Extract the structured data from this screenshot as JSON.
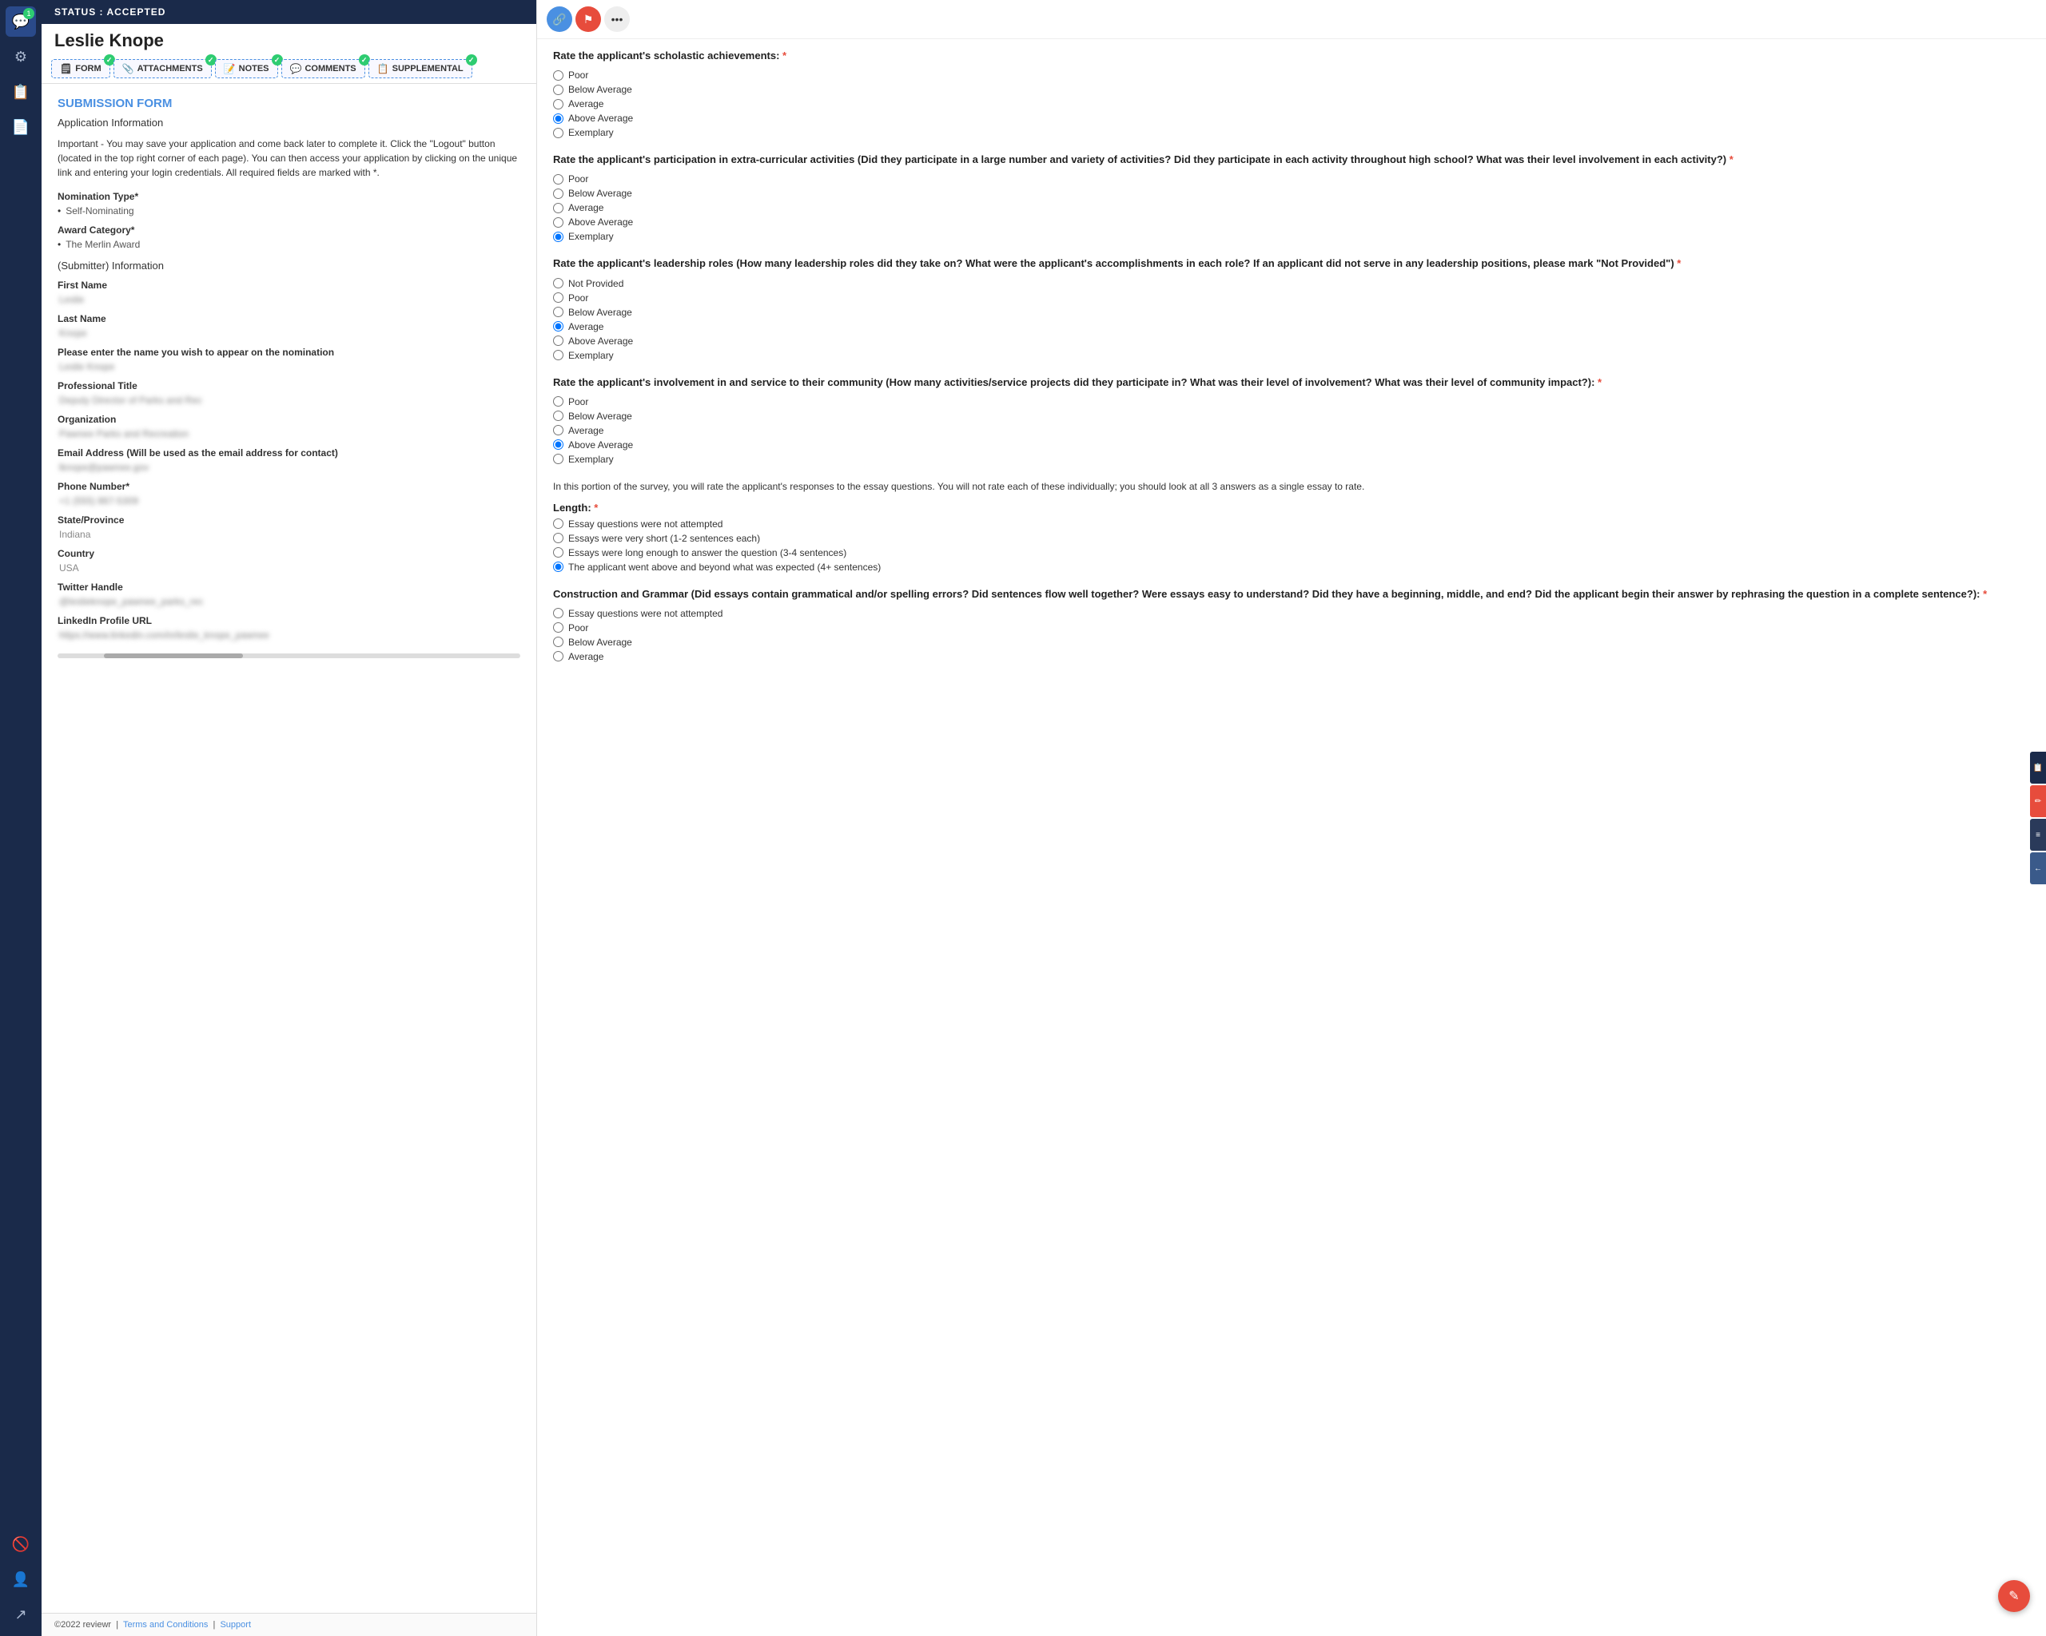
{
  "sidebar": {
    "icons": [
      {
        "name": "chat-icon",
        "symbol": "💬",
        "active": true,
        "badge": "1"
      },
      {
        "name": "settings-icon",
        "symbol": "⚙",
        "active": false
      },
      {
        "name": "clipboard-icon",
        "symbol": "📋",
        "active": false
      },
      {
        "name": "document-icon",
        "symbol": "📄",
        "active": false
      }
    ],
    "bottom_icons": [
      {
        "name": "block-icon",
        "symbol": "🚫"
      },
      {
        "name": "user-icon",
        "symbol": "👤"
      },
      {
        "name": "export-icon",
        "symbol": "↗"
      }
    ]
  },
  "status_bar": {
    "text": "STATUS : ACCEPTED"
  },
  "applicant": {
    "name": "Leslie Knope"
  },
  "tabs": [
    {
      "id": "form",
      "label": "FORM",
      "icon": "🗒",
      "checked": true
    },
    {
      "id": "attachments",
      "label": "ATTACHMENTS",
      "icon": "📎",
      "checked": true
    },
    {
      "id": "notes",
      "label": "NOTES",
      "icon": "📝",
      "checked": true
    },
    {
      "id": "comments",
      "label": "COMMENTS",
      "icon": "💬",
      "checked": true
    },
    {
      "id": "supplemental",
      "label": "SUPPLEMENTAL",
      "icon": "📋",
      "checked": true
    }
  ],
  "form": {
    "title": "SUBMISSION FORM",
    "subtitle": "Application Information",
    "instructions": "Important - You may save your application and come back later to complete it. Click the \"Logout\" button (located in the top right corner of each page). You can then access your application by clicking on the unique link and entering your login credentials. All required fields are marked with *.",
    "fields": [
      {
        "label": "Nomination Type*",
        "value": "Self-Nominating",
        "bullet": true
      },
      {
        "label": "Award Category*",
        "value": "The Merlin Award",
        "bullet": true
      },
      {
        "label": "submitter_section",
        "value": "(Submitter) Information"
      },
      {
        "label": "First Name",
        "value": "••••••"
      },
      {
        "label": "Last Name",
        "value": "••••••"
      },
      {
        "label": "Please enter the name you wish to appear on the nomination",
        "value": "•••••• ••••••"
      },
      {
        "label": "Professional Title",
        "value": "•••••• •••••• •• •••••• ••• •••"
      },
      {
        "label": "Organization",
        "value": "•••••••• •••••• ••• ••• ••••••"
      },
      {
        "label": "Email Address (Will be used as the email address for contact)",
        "value": "•••••• •••••"
      },
      {
        "label": "Phone Number*",
        "value": "•• •••••• •••• •••"
      },
      {
        "label": "State/Province",
        "value": "Indiana"
      },
      {
        "label": "Country",
        "value": "USA"
      },
      {
        "label": "Twitter Handle",
        "value": "•••••• •••••• •••• •••••• •••• ••"
      },
      {
        "label": "LinkedIn Profile URL",
        "value": "•••••• •••••• •••••• •• •••••• •••••• ••••"
      }
    ]
  },
  "right_panel": {
    "rating_sections": [
      {
        "id": "scholastic",
        "question": "Rate the applicant's scholastic achievements:",
        "required": true,
        "options": [
          "Poor",
          "Below Average",
          "Average",
          "Above Average",
          "Exemplary"
        ],
        "selected": "Above Average"
      },
      {
        "id": "extracurricular",
        "question": "Rate the applicant's participation in extra-curricular activities (Did they participate in a large number and variety of activities? Did they participate in each activity throughout high school? What was their level involvement in each activity?)",
        "required": true,
        "options": [
          "Poor",
          "Below Average",
          "Average",
          "Above Average",
          "Exemplary"
        ],
        "selected": "Exemplary"
      },
      {
        "id": "leadership",
        "question": "Rate the applicant's leadership roles (How many leadership roles did they take on? What were the applicant's accomplishments in each role? If an applicant did not serve in any leadership positions, please mark \"Not Provided\")",
        "required": true,
        "options": [
          "Not Provided",
          "Poor",
          "Below Average",
          "Average",
          "Above Average",
          "Exemplary"
        ],
        "selected": "Average"
      },
      {
        "id": "community",
        "question": "Rate the applicant's involvement in and service to their community (How many activities/service projects did they participate in? What was their level of involvement? What was their level of community impact?):",
        "required": true,
        "options": [
          "Poor",
          "Below Average",
          "Average",
          "Above Average",
          "Exemplary"
        ],
        "selected": "Above Average"
      }
    ],
    "essay_section": {
      "intro": "In this portion of the survey, you will rate the applicant's responses to the essay questions. You will not rate each of these individually; you should look at all 3 answers as a single essay to rate.",
      "length_label": "Length:",
      "length_required": true,
      "length_options": [
        "Essay questions were not attempted",
        "Essays were very short (1-2 sentences each)",
        "Essays were long enough to answer the question (3-4 sentences)",
        "The applicant went above and beyond what was expected (4+ sentences)"
      ],
      "length_selected": "The applicant went above and beyond what was expected (4+ sentences)",
      "grammar_question": "Construction and Grammar (Did essays contain grammatical and/or spelling errors? Did sentences flow well together? Were essays easy to understand? Did they have a beginning, middle, and end? Did the applicant begin their answer by rephrasing the question in a complete sentence?):",
      "grammar_required": true,
      "grammar_options": [
        "Essay questions were not attempted",
        "Poor",
        "Below Average",
        "Average"
      ],
      "grammar_selected": ""
    }
  },
  "footer": {
    "copyright": "©2022 reviewr",
    "links": [
      "Terms and Conditions",
      "Support"
    ]
  }
}
